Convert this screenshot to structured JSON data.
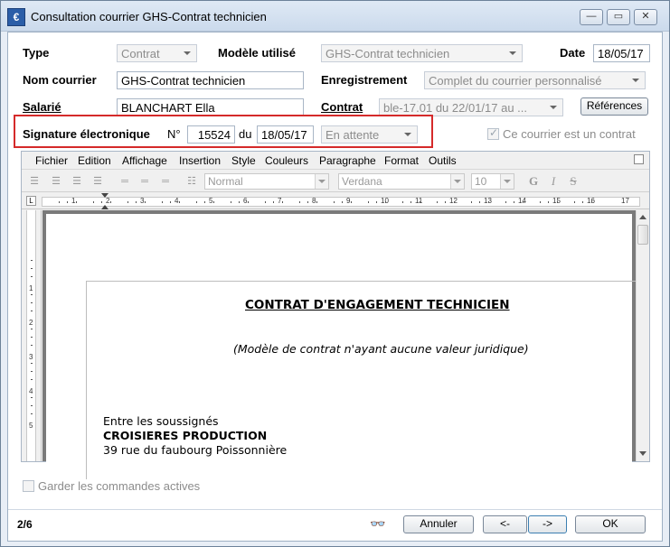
{
  "window": {
    "title": "Consultation courrier GHS-Contrat technicien"
  },
  "form": {
    "type_label": "Type",
    "type_value": "Contrat",
    "modele_label": "Modèle utilisé",
    "modele_value": "GHS-Contrat technicien",
    "date_label": "Date",
    "date_value": "18/05/17",
    "nom_label": "Nom courrier",
    "nom_value": "GHS-Contrat technicien",
    "enreg_label": "Enregistrement",
    "enreg_value": "Complet du courrier personnalisé",
    "salarie_label": "Salarié",
    "salarie_value": "BLANCHART Ella",
    "contrat_label": "Contrat",
    "contrat_value": "ble-17.01 du 22/01/17 au ...",
    "references_label": "Références",
    "signature_label": "Signature électronique",
    "num_label": "N°",
    "num_value": "15524",
    "du_label": "du",
    "sig_date": "18/05/17",
    "sig_status": "En attente",
    "ce_courrier_label": "Ce courrier est un contrat"
  },
  "editor": {
    "menus": [
      "Fichier",
      "Edition",
      "Affichage",
      "Insertion",
      "Style",
      "Couleurs",
      "Paragraphe",
      "Format",
      "Outils"
    ],
    "style_value": "Normal",
    "font_value": "Verdana",
    "size_value": "10",
    "bold_label": "G",
    "italic_label": "I",
    "strike_label": "S",
    "ruler_h": [
      "1",
      "2",
      "3",
      "4",
      "5",
      "6",
      "7",
      "8",
      "9",
      "10",
      "11",
      "12",
      "13",
      "14",
      "15",
      "16",
      "17"
    ],
    "ruler_v": [
      "1",
      "2",
      "3",
      "4",
      "5"
    ]
  },
  "document": {
    "title": "CONTRAT D'ENGAGEMENT TECHNICIEN",
    "subtitle": "(Modèle de contrat n'ayant aucune valeur juridique)",
    "line1": "Entre les soussignés",
    "line2": "CROISIERES PRODUCTION",
    "line3": "39 rue du faubourg Poissonnière"
  },
  "footer": {
    "garder_label": "Garder les commandes actives",
    "page_indicator": "2/6",
    "annuler_label": "Annuler",
    "prev_label": "<-",
    "next_label": "->",
    "ok_label": "OK"
  }
}
